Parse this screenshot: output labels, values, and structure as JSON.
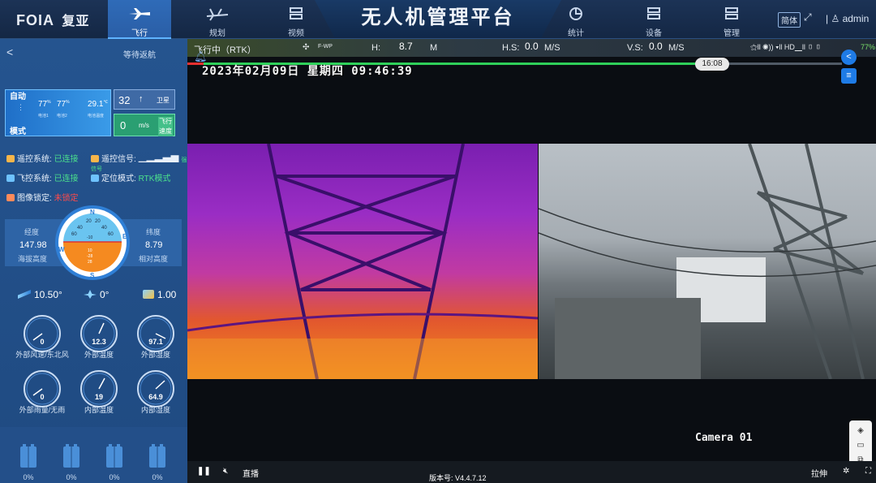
{
  "brand": {
    "logo": "FOIA",
    "name": "复亚"
  },
  "nav": [
    {
      "label": "飞行",
      "icon": "plane-icon",
      "active": true
    },
    {
      "label": "规划",
      "icon": "plan-icon"
    },
    {
      "label": "视频",
      "icon": "video-icon"
    },
    {
      "label": "统计",
      "icon": "stats-icon"
    },
    {
      "label": "设备",
      "icon": "device-icon"
    },
    {
      "label": "管理",
      "icon": "manage-icon"
    }
  ],
  "title": "无人机管理平台",
  "header": {
    "lang": "简体",
    "user": "admin"
  },
  "left": {
    "back": "<",
    "status": "等待返航",
    "mode_top": "自动",
    "mode_bottom": "模式",
    "batt1": "77",
    "batt1_label": "电池1",
    "batt2": "77",
    "batt2_label": "电池2",
    "batt_unit": "%",
    "batt_temp": "29.1",
    "batt_temp_unit": "℃",
    "batt_temp_label": "电池温度",
    "satellites": "32",
    "sat_arrow": "↑",
    "sat_label": "卫星",
    "speed": "0",
    "speed_unit": "m/s",
    "speed_label_1": "飞行",
    "speed_label_2": "速度",
    "rc_label": "遥控系统:",
    "rc_value": "已连接",
    "signal_label": "遥控信号:",
    "signal_value": "强信号",
    "fc_label": "飞控系统:",
    "fc_value": "已连接",
    "pos_label": "定位模式:",
    "pos_value": "RTK模式",
    "lock_label": "图像锁定:",
    "lock_value": "未锁定",
    "lon_label": "经度",
    "lat_label": "纬度",
    "alt": "147.98",
    "alt_label": "海拔高度",
    "rel_alt": "8.79",
    "rel_alt_label": "相对高度",
    "roll": "10.50°",
    "yaw": "0°",
    "zoom": "1.00",
    "gauges": [
      {
        "value": "0",
        "label": "外部风速/东北风"
      },
      {
        "value": "12.3",
        "label": "外部温度"
      },
      {
        "value": "97.1",
        "label": "外部湿度"
      },
      {
        "value": "0",
        "label": "外部雨量/无雨"
      },
      {
        "value": "19",
        "label": "内部温度"
      },
      {
        "value": "64.9",
        "label": "内部湿度"
      }
    ],
    "batteries": [
      "0%",
      "0%",
      "0%",
      "0%"
    ]
  },
  "attitude": {
    "n": "N",
    "s": "S",
    "e": "E",
    "w": "W",
    "ticks": [
      "20",
      "20",
      "40",
      "40",
      "60",
      "60"
    ],
    "inner": [
      "-10",
      "10",
      "-28",
      "28"
    ]
  },
  "video": {
    "flight_state": "飞行中（RTK）",
    "fwp": "F-WP",
    "h_label": "H:",
    "h_value": "8.7",
    "m": "M",
    "hs_label": "H.S:",
    "hs_value": "0.0",
    "hs_unit": "M/S",
    "vs_label": "V.S:",
    "vs_value": "0.0",
    "vs_unit": "M/S",
    "flag_time": "16:08",
    "osd": "2023年02月09日  星期四  09:46:39",
    "camera": "Camera 01",
    "live": "直播",
    "version": "版本号: V4.4.7.12",
    "stretch": "拉伸",
    "battery_pct": "77%",
    "progress": 0.74
  }
}
